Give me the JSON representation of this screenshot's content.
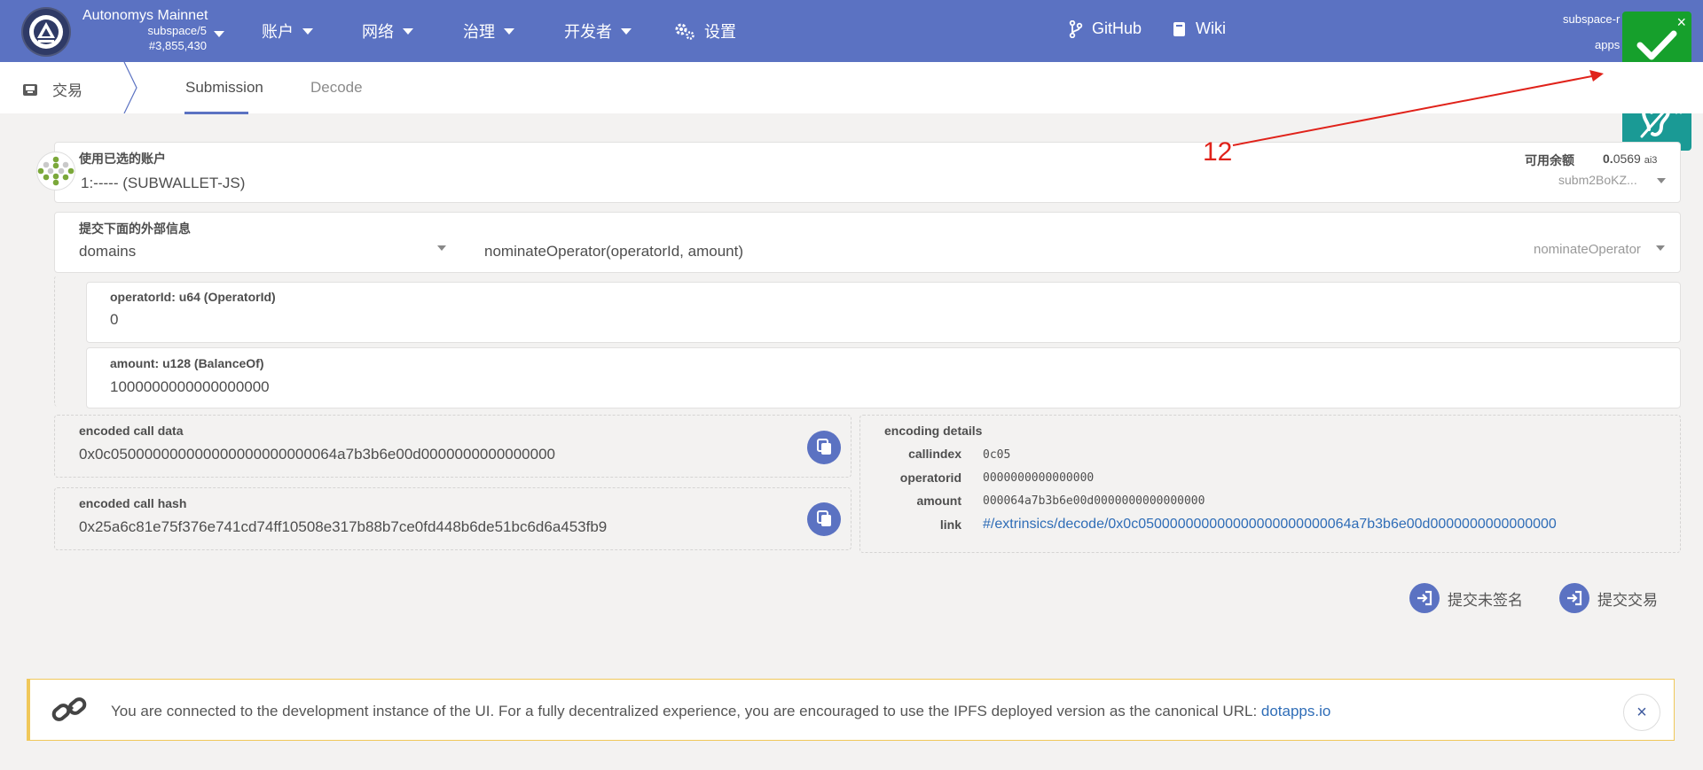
{
  "header": {
    "chain_name": "Autonomys Mainnet",
    "spec": "subspace/5",
    "block": "#3,855,430",
    "nav": [
      {
        "label": "账户"
      },
      {
        "label": "网络"
      },
      {
        "label": "治理"
      },
      {
        "label": "开发者"
      },
      {
        "label": "设置"
      }
    ],
    "github": "GitHub",
    "wiki": "Wiki",
    "right_line1": "subspace-r",
    "right_line2": "apps"
  },
  "subnav": {
    "section": "交易",
    "tabs": [
      {
        "label": "Submission"
      },
      {
        "label": "Decode"
      }
    ]
  },
  "account": {
    "label": "使用已选的账户",
    "value": "1:----- (SUBWALLET-JS)",
    "balance_label": "可用余额",
    "balance_int": "0.",
    "balance_dec": "0569",
    "balance_unit": "ai3",
    "address": "subm2BoKZ..."
  },
  "extrinsic": {
    "label": "提交下面的外部信息",
    "module": "domains",
    "call": "nominateOperator(operatorId, amount)",
    "call_short": "nominateOperator"
  },
  "params": [
    {
      "label": "operatorId: u64 (OperatorId)",
      "value": "0"
    },
    {
      "label": "amount: u128 (BalanceOf)",
      "value": "1000000000000000000"
    }
  ],
  "encoded": {
    "data_label": "encoded call data",
    "data_value": "0x0c050000000000000000000000064a7b3b6e00d0000000000000000",
    "hash_label": "encoded call hash",
    "hash_value": "0x25a6c81e75f376e741cd74ff10508e317b88b7ce0fd448b6de51bc6d6a453fb9"
  },
  "details": {
    "title": "encoding details",
    "rows": [
      {
        "key": "callindex",
        "value": "0c05"
      },
      {
        "key": "operatorid",
        "value": "0000000000000000"
      },
      {
        "key": "amount",
        "value": "000064a7b3b6e00d0000000000000000"
      },
      {
        "key": "link",
        "value": "#/extrinsics/decode/0x0c050000000000000000000000064a7b3b6e00d0000000000000000"
      }
    ]
  },
  "actions": {
    "unsigned": "提交未签名",
    "submit": "提交交易"
  },
  "notice": {
    "text": "You are connected to the development instance of the UI. For a fully decentralized experience, you are encouraged to use the IPFS deployed version as the canonical URL: ",
    "link": "dotapps.io",
    "close": "×"
  },
  "annotation": {
    "number": "12"
  },
  "colors": {
    "brand": "#5b72c2",
    "success": "#16a02c",
    "teal": "#1a9a95",
    "warning": "#f0c85a",
    "annotation": "#e0221a"
  },
  "icons": {
    "toast1": "check-icon",
    "toast2": "ear-icon",
    "settings": "gears-icon",
    "github": "git-branch-icon",
    "wiki": "book-icon",
    "section": "inbox-icon",
    "copy": "copy-icon",
    "action": "sign-in-icon",
    "notice": "link-icon"
  }
}
